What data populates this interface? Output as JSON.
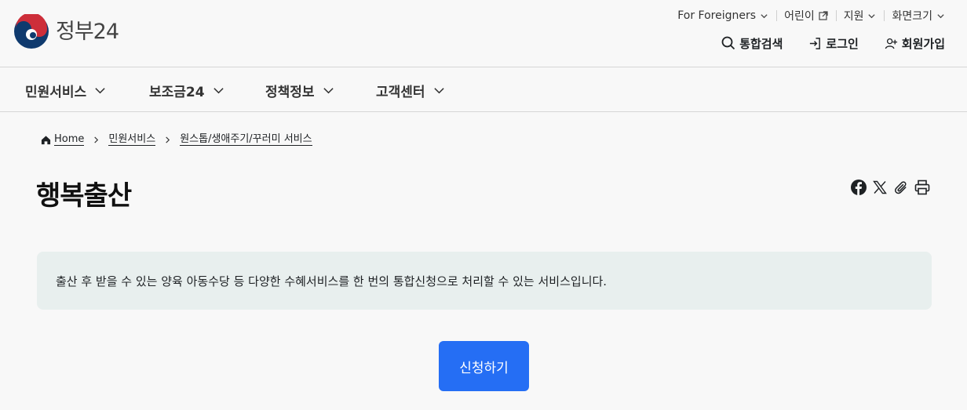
{
  "logo": {
    "text": "정부24",
    "colors": {
      "red": "#cd2e3a",
      "blue": "#0f3a6e"
    }
  },
  "utility_links": [
    {
      "label": "For Foreigners",
      "icon": "chevron-down-icon"
    },
    {
      "label": "어린이",
      "icon": "external-link-icon"
    },
    {
      "label": "지원",
      "icon": "chevron-down-icon"
    },
    {
      "label": "화면크기",
      "icon": "chevron-down-icon"
    }
  ],
  "header_actions": [
    {
      "label": "통합검색",
      "icon": "search-icon"
    },
    {
      "label": "로그인",
      "icon": "login-icon"
    },
    {
      "label": "회원가입",
      "icon": "user-add-icon"
    }
  ],
  "gnb": [
    {
      "label": "민원서비스"
    },
    {
      "label": "보조금24"
    },
    {
      "label": "정책정보"
    },
    {
      "label": "고객센터"
    }
  ],
  "breadcrumb": [
    "Home",
    "민원서비스",
    "원스톱/생애주기/꾸러미 서비스"
  ],
  "page": {
    "title": "행복출산",
    "description": "출산 후 받을 수 있는 양육 아동수당 등 다양한 수혜서비스를 한 번의 통합신청으로 처리할 수 있는 서비스입니다.",
    "apply_label": "신청하기"
  },
  "share_icons": [
    "facebook-icon",
    "x-icon",
    "link-icon",
    "print-icon"
  ],
  "colors": {
    "primary": "#256ef4",
    "info_bg": "#e8efee"
  }
}
